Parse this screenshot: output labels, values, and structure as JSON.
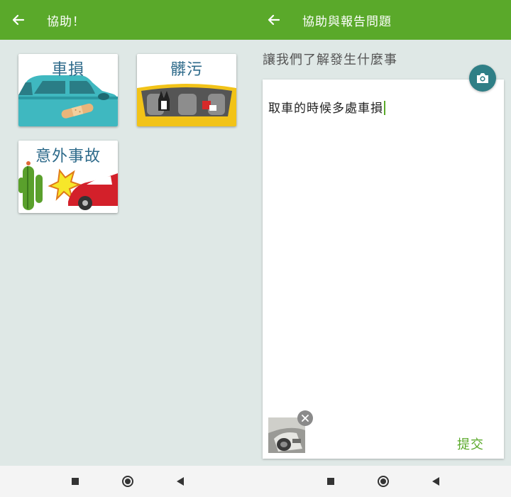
{
  "left_screen": {
    "title": "協助！",
    "categories": [
      {
        "label": "車損"
      },
      {
        "label": "髒污"
      },
      {
        "label": "意外事故"
      }
    ]
  },
  "right_screen": {
    "title": "協助與報告問題",
    "prompt": "讓我們了解發生什麼事",
    "report_text": "取車的時候多處車損",
    "submit_label": "提交"
  },
  "icons": {
    "back": "arrow-left-icon",
    "camera": "camera-icon",
    "remove": "close-icon",
    "nav_recents": "square-icon",
    "nav_home": "circle-icon",
    "nav_back": "triangle-back-icon"
  },
  "colors": {
    "appbar": "#5aa92a",
    "accent_teal": "#2f7f86",
    "submit_green": "#5aa92a",
    "background": "#dfe8e6"
  }
}
